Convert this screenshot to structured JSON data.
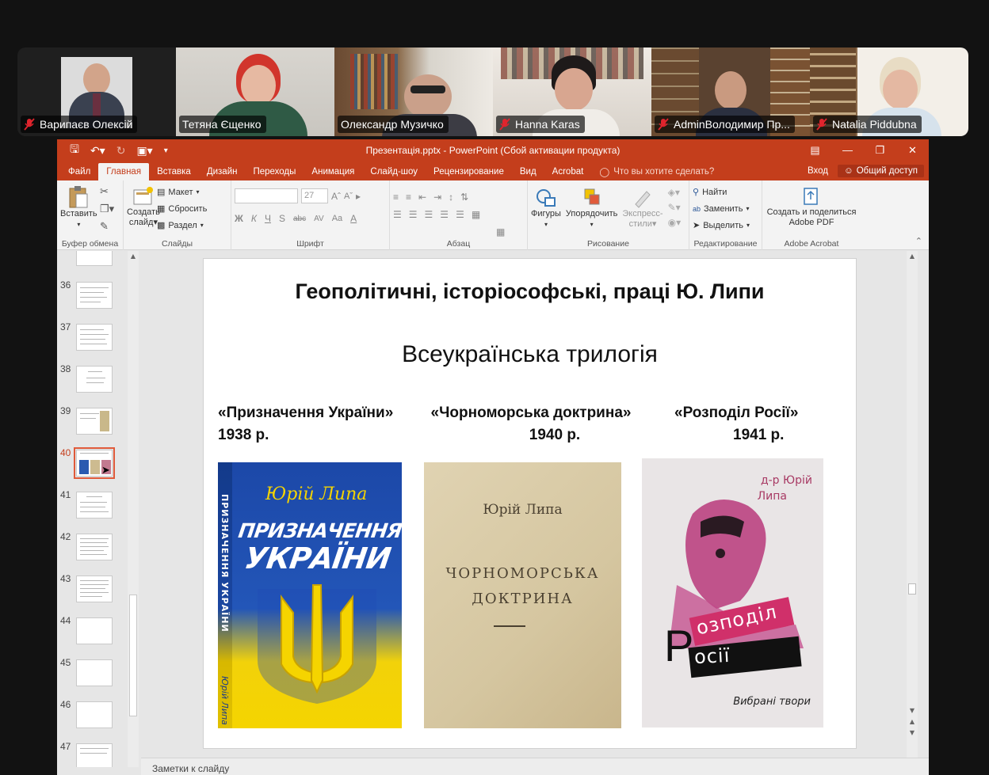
{
  "participants": [
    {
      "name": "Варипаєв Олексій",
      "muted": true
    },
    {
      "name": "Тетяна Єщенко",
      "muted": false
    },
    {
      "name": "Олександр Музичко",
      "muted": false,
      "active_speaker": true
    },
    {
      "name": "Hanna Karas",
      "muted": true
    },
    {
      "name": "AdminВолодимир Пр...",
      "muted": true
    },
    {
      "name": "Natalia Piddubna",
      "muted": true
    }
  ],
  "window": {
    "title": "Презентація.pptx - PowerPoint (Сбой активации продукта)",
    "tabs": [
      "Файл",
      "Главная",
      "Вставка",
      "Дизайн",
      "Переходы",
      "Анимация",
      "Слайд-шоу",
      "Рецензирование",
      "Вид",
      "Acrobat"
    ],
    "active_tab": "Главная",
    "tell_me": "Что вы хотите сделать?",
    "sign_in": "Вход",
    "share": "Общий доступ",
    "accent": "#c43e1c"
  },
  "ribbon": {
    "clipboard": {
      "paste": "Вставить",
      "label": "Буфер обмена"
    },
    "slides": {
      "new_slide_1": "Создать",
      "new_slide_2": "слайд",
      "layout": "Макет",
      "reset": "Сбросить",
      "section": "Раздел",
      "label": "Слайды"
    },
    "font": {
      "size": "27",
      "bold": "Ж",
      "italic": "К",
      "underline": "Ч",
      "shadow": "S",
      "strike": "abc",
      "spacing": "AV",
      "case": "Aa",
      "color": "A",
      "label": "Шрифт"
    },
    "paragraph": {
      "label": "Абзац"
    },
    "drawing": {
      "shapes": "Фигуры",
      "arrange": "Упорядочить",
      "styles_1": "Экспресс-",
      "styles_2": "стили",
      "label": "Рисование"
    },
    "editing": {
      "find": "Найти",
      "replace": "Заменить",
      "select": "Выделить",
      "label": "Редактирование"
    },
    "acrobat": {
      "create_1": "Создать и поделиться",
      "create_2": "Adobe PDF",
      "label": "Adobe Acrobat"
    }
  },
  "thumbnails": [
    {
      "num": "36"
    },
    {
      "num": "37"
    },
    {
      "num": "38"
    },
    {
      "num": "39"
    },
    {
      "num": "40",
      "active": true
    },
    {
      "num": "41"
    },
    {
      "num": "42"
    },
    {
      "num": "43"
    },
    {
      "num": "44"
    },
    {
      "num": "45"
    },
    {
      "num": "46"
    },
    {
      "num": "47"
    }
  ],
  "slide": {
    "title": "Геополітичні, історіософські, праці Ю. Липи",
    "subtitle": "Всеукраїнська трилогія",
    "books": [
      {
        "title": "«Призначення України»",
        "year": "1938 р.",
        "cover_author": "Юрій Липа",
        "cover_title_1": "ПРИЗНАЧЕННЯ",
        "cover_title_2": "УКРАЇНИ",
        "spine_text": "ПРИЗНАЧЕННЯ УКРАЇНИ",
        "spine_author": "Юрій Липа"
      },
      {
        "title": "«Чорноморська доктрина»",
        "year": "1940  р.",
        "cover_author": "Юрій Липа",
        "cover_title_1": "ЧОРНОМОРСЬКА",
        "cover_title_2": "ДОКТРИНА"
      },
      {
        "title": "«Розподіл Росії»",
        "year": "1941 р.",
        "cover_author_1": "д-р Юрій",
        "cover_author_2": "Липа",
        "cover_big_r": "Р",
        "cover_title_1": "озподіл",
        "cover_title_2": "осії",
        "cover_footer": "Вибрані твори"
      }
    ]
  },
  "notes_label": "Заметки к слайду"
}
